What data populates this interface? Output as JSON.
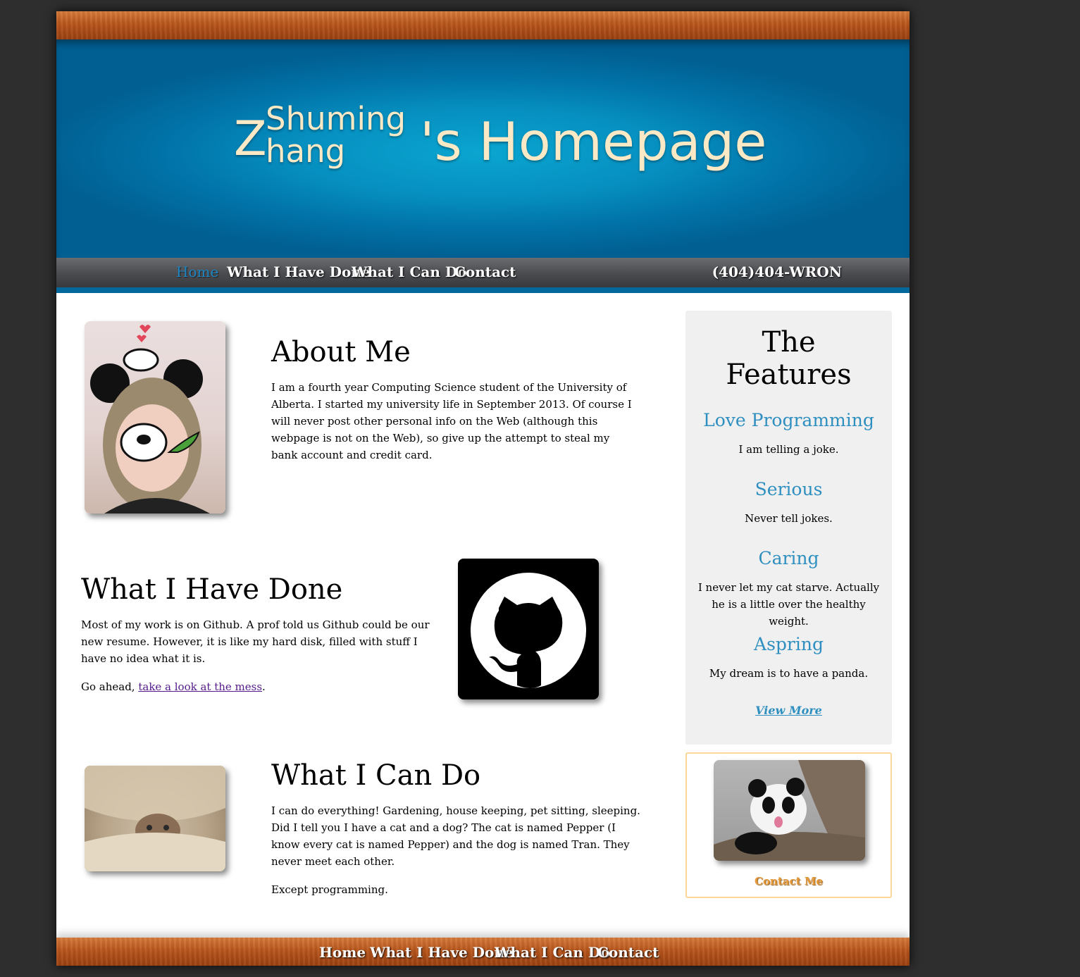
{
  "header": {
    "name_initial": "Z",
    "name_first": "Shuming",
    "name_rest": "hang",
    "title_suffix": "'s Homepage"
  },
  "nav": {
    "items": [
      {
        "label": "Home",
        "active": true
      },
      {
        "label": "What I Have Done",
        "active": false
      },
      {
        "label": "What I Can Do",
        "active": false
      },
      {
        "label": "Contact",
        "active": false
      }
    ],
    "phone": "(404)404-WRON"
  },
  "about": {
    "heading": "About Me",
    "text": "I am a fourth year Computing Science student of the University of Alberta. I started my university life in September 2013. Of course I will never post other personal info on the Web (although this webpage is not on the Web), so give up the attempt to steal my bank account and credit card."
  },
  "done": {
    "heading": "What I Have Done",
    "text": "Most of my work is on Github. A prof told us Github could be our new resume. However, it is like my hard disk, filled with stuff I have no idea what it is.",
    "cta_prefix": "Go ahead, ",
    "cta_link": "take a look at the mess",
    "cta_suffix": "."
  },
  "cando": {
    "heading": "What I Can Do",
    "text": "I can do everything! Gardening, house keeping, pet sitting, sleeping. Did I tell you I have a cat and a dog? The cat is named Pepper (I know every cat is named Pepper) and the dog is named Tran. They never meet each other.",
    "text2": "Except programming."
  },
  "features": {
    "title_line1": "The",
    "title_line2": "Features",
    "items": [
      {
        "heading": "Love Programming",
        "text": "I am telling a joke."
      },
      {
        "heading": "Serious",
        "text": "Never tell jokes."
      },
      {
        "heading": "Caring",
        "text": "I never let my cat starve. Actually he is a little over the healthy weight."
      },
      {
        "heading": "Aspring",
        "text": "My dream is to have a panda."
      }
    ],
    "view_more": "View More"
  },
  "contact_box": {
    "link": "Contact Me"
  },
  "footer": {
    "items": [
      "Home",
      "What I Have Done",
      "What I Can Do",
      "Contact"
    ]
  },
  "colors": {
    "banner_blue": "#068fc0",
    "accent_blue": "#2e8fc0",
    "title_cream": "#fbe9c6",
    "wood": "#b8561c",
    "contact_orange": "#e69a3a"
  },
  "icons": {
    "github": "github-octocat-icon"
  }
}
